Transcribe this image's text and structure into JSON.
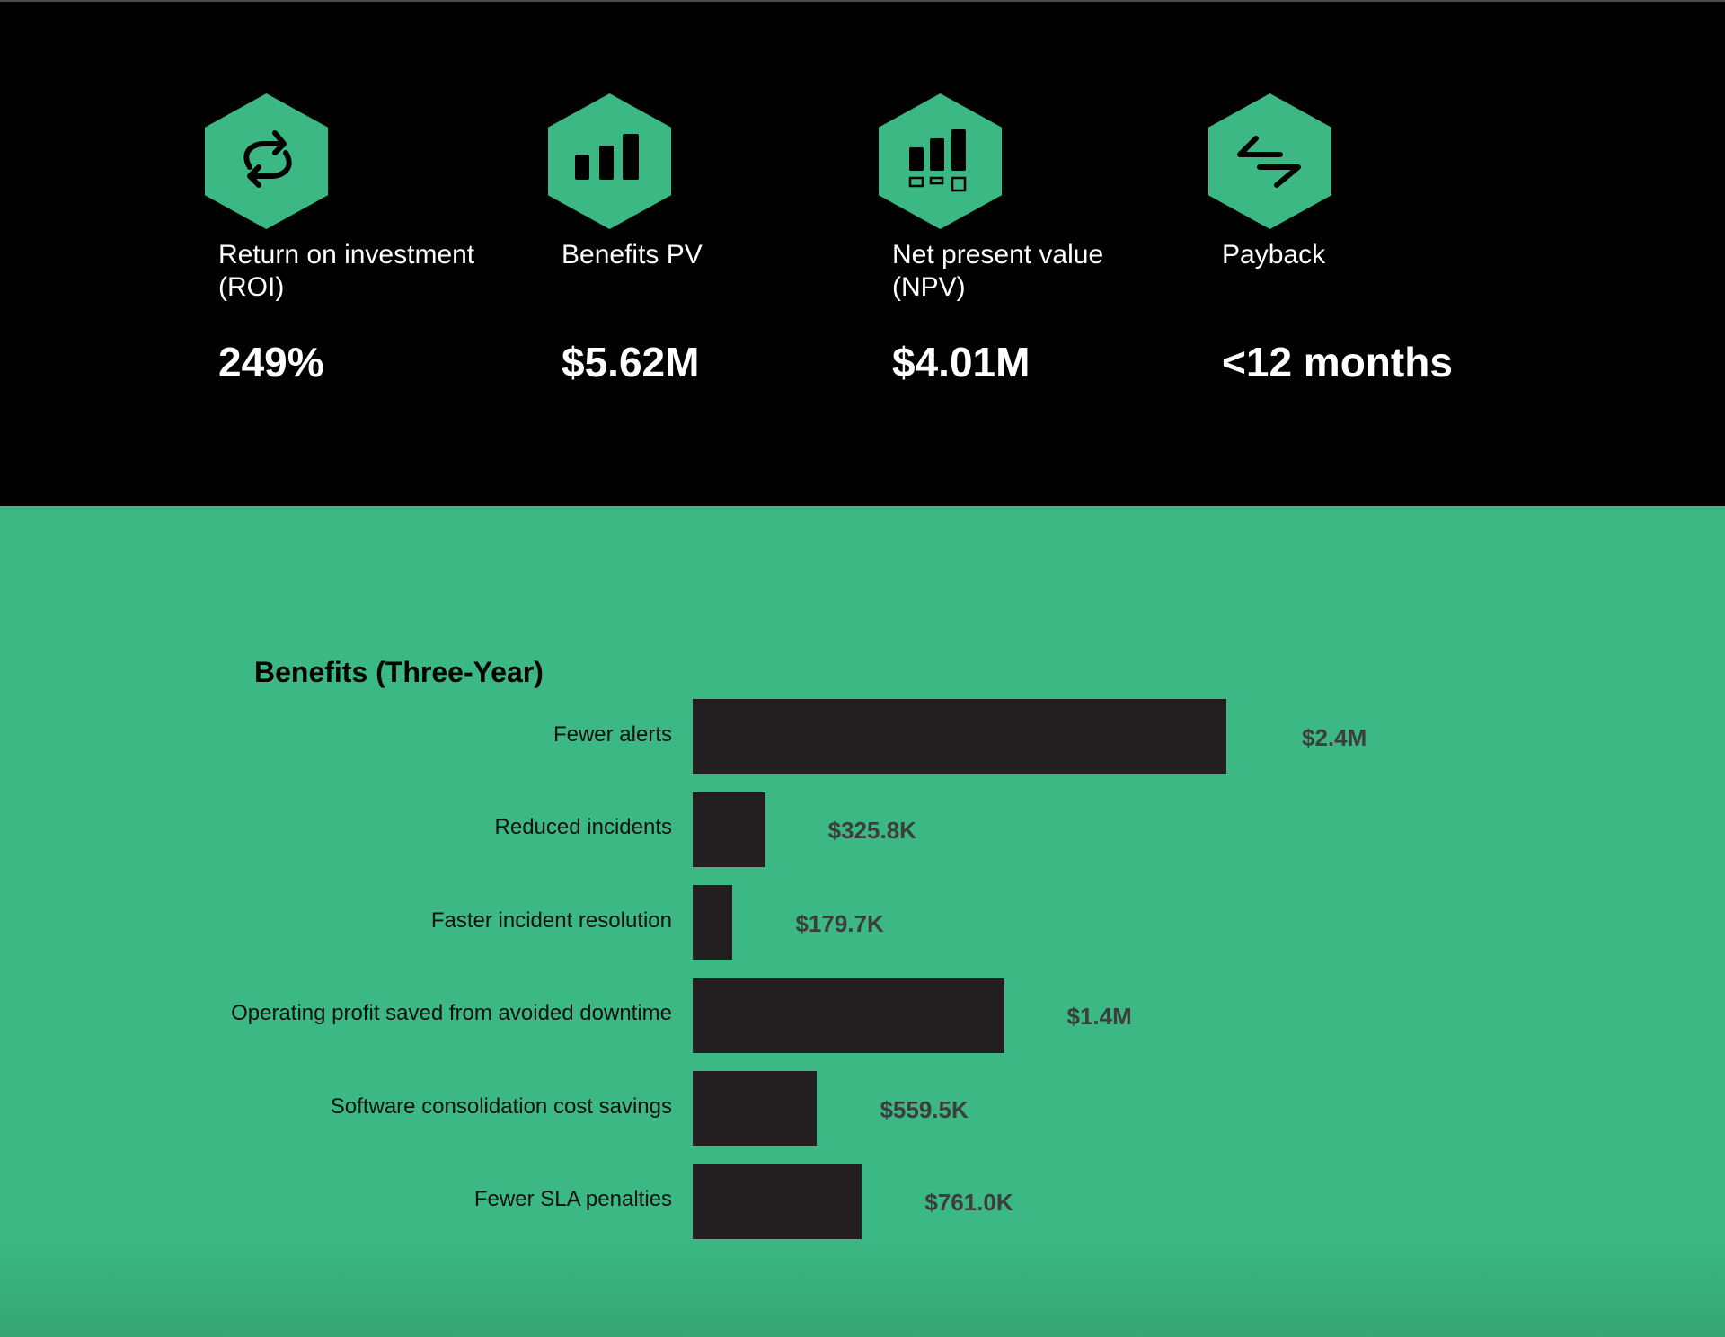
{
  "colors": {
    "accent_green": "#3bb883",
    "top_background": "#000000",
    "bar_color": "#231f20",
    "value_label_color": "#3d3d3d"
  },
  "kpis": [
    {
      "icon": "repeat-arrows-icon",
      "label": "Return on investment\n(ROI)",
      "value": "249%"
    },
    {
      "icon": "bar-chart-icon",
      "label": "Benefits PV",
      "value": "$5.62M"
    },
    {
      "icon": "bar-chart-boxes-icon",
      "label": "Net present value\n(NPV)",
      "value": "$4.01M"
    },
    {
      "icon": "swap-arrows-icon",
      "label": "Payback",
      "value": "<12 months"
    }
  ],
  "chart_data": {
    "type": "bar",
    "orientation": "horizontal",
    "title": "Benefits (Three-Year)",
    "xlabel": "",
    "ylabel": "",
    "grid": false,
    "categories": [
      "Fewer alerts",
      "Reduced incidents",
      "Faster incident resolution",
      "Operating profit saved from avoided downtime",
      "Software consolidation cost savings",
      "Fewer SLA penalties"
    ],
    "values": [
      2400000,
      325800,
      179700,
      1400000,
      559500,
      761000
    ],
    "value_labels": [
      "$2.4M",
      "$325.8K",
      "$179.7K",
      "$1.4M",
      "$559.5K",
      "$761.0K"
    ],
    "xlim": [
      0,
      2400000
    ]
  }
}
